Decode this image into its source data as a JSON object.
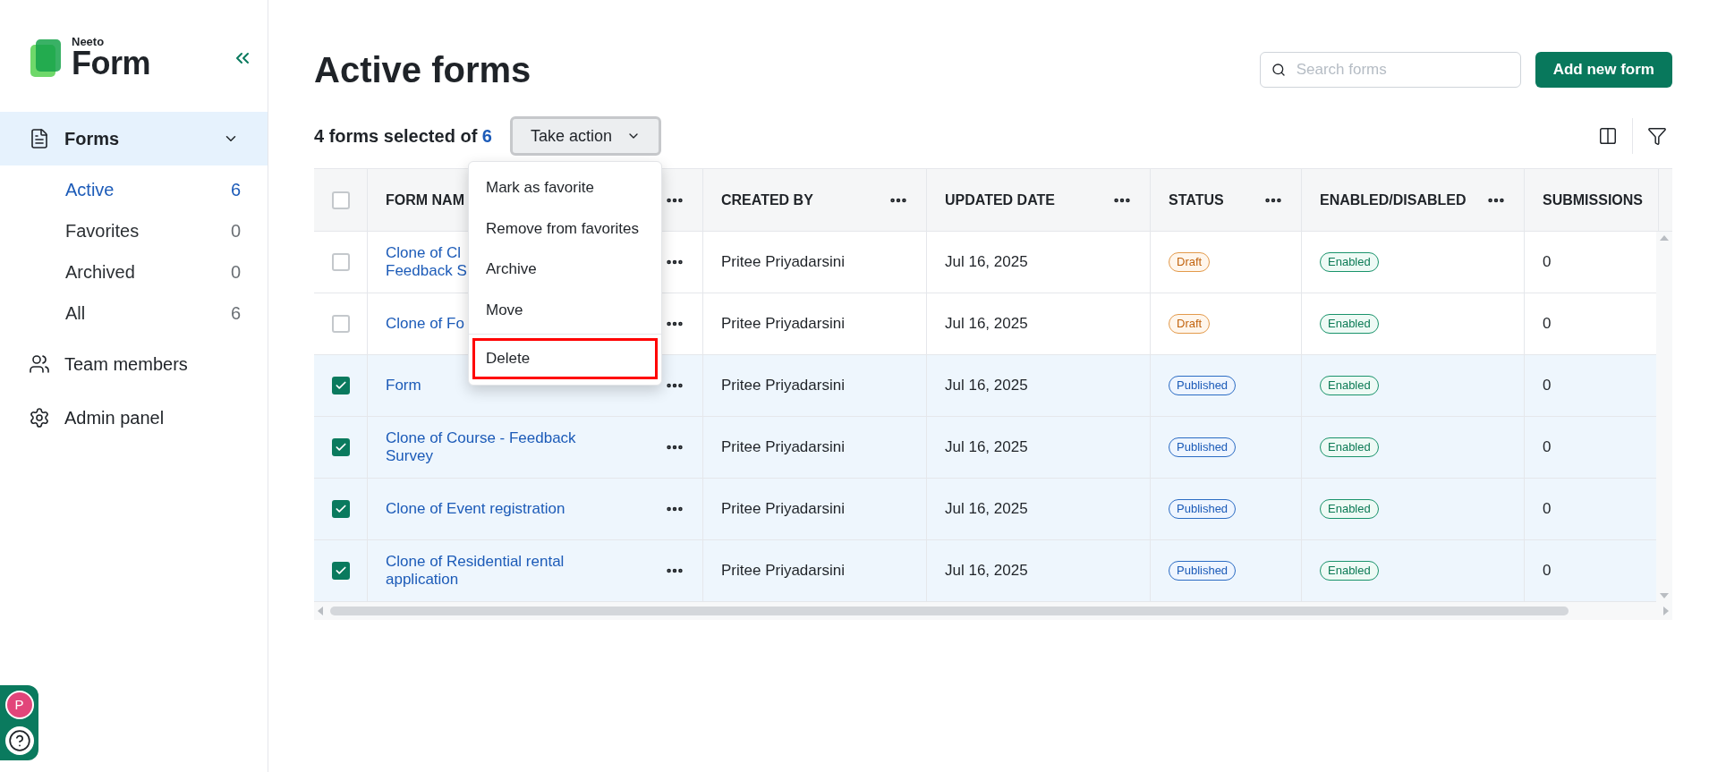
{
  "sidebar": {
    "logo": {
      "small": "Neeto",
      "large": "Form"
    },
    "items": [
      {
        "label": "Forms",
        "selected": true,
        "expanded": true,
        "children": [
          {
            "label": "Active",
            "count": "6",
            "selected": true
          },
          {
            "label": "Favorites",
            "count": "0",
            "selected": false
          },
          {
            "label": "Archived",
            "count": "0",
            "selected": false
          },
          {
            "label": "All",
            "count": "6",
            "selected": false
          }
        ]
      },
      {
        "label": "Team members",
        "selected": false
      },
      {
        "label": "Admin panel",
        "selected": false
      }
    ],
    "user_initial": "P"
  },
  "header": {
    "title": "Active forms",
    "search": {
      "placeholder": "Search forms"
    },
    "add_button": "Add new form"
  },
  "selection": {
    "text": "4 forms selected of",
    "total": "6",
    "action_button": "Take action"
  },
  "action_menu": {
    "items": [
      {
        "label": "Mark as favorite",
        "highlighted": false
      },
      {
        "label": "Remove from favorites",
        "highlighted": false
      },
      {
        "label": "Archive",
        "highlighted": false
      },
      {
        "label": "Move",
        "highlighted": false
      },
      {
        "label": "Delete",
        "highlighted": true
      }
    ]
  },
  "table": {
    "all_selected": false,
    "columns": [
      {
        "label": "FORM NAM",
        "menu": true
      },
      {
        "label": "CREATED BY",
        "menu": true
      },
      {
        "label": "UPDATED DATE",
        "menu": true
      },
      {
        "label": "STATUS",
        "menu": true
      },
      {
        "label": "ENABLED/DISABLED",
        "menu": true
      },
      {
        "label": "SUBMISSIONS"
      }
    ],
    "rows": [
      {
        "selected": false,
        "name_lines": [
          "Clone of Cl",
          "Feedback S"
        ],
        "created_by": "Pritee Priyadarsini",
        "updated": "Jul 16, 2025",
        "status": {
          "label": "Draft",
          "kind": "draft"
        },
        "enabled": "Enabled",
        "submissions": "0"
      },
      {
        "selected": false,
        "name_lines": [
          "Clone of Fo"
        ],
        "created_by": "Pritee Priyadarsini",
        "updated": "Jul 16, 2025",
        "status": {
          "label": "Draft",
          "kind": "draft"
        },
        "enabled": "Enabled",
        "submissions": "0"
      },
      {
        "selected": true,
        "name_lines": [
          "Form"
        ],
        "created_by": "Pritee Priyadarsini",
        "updated": "Jul 16, 2025",
        "status": {
          "label": "Published",
          "kind": "published"
        },
        "enabled": "Enabled",
        "submissions": "0"
      },
      {
        "selected": true,
        "name_lines": [
          "Clone of Course - Feedback",
          "Survey"
        ],
        "created_by": "Pritee Priyadarsini",
        "updated": "Jul 16, 2025",
        "status": {
          "label": "Published",
          "kind": "published"
        },
        "enabled": "Enabled",
        "submissions": "0"
      },
      {
        "selected": true,
        "name_lines": [
          "Clone of Event registration"
        ],
        "created_by": "Pritee Priyadarsini",
        "updated": "Jul 16, 2025",
        "status": {
          "label": "Published",
          "kind": "published"
        },
        "enabled": "Enabled",
        "submissions": "0"
      },
      {
        "selected": true,
        "name_lines": [
          "Clone of Residential rental",
          "application"
        ],
        "created_by": "Pritee Priyadarsini",
        "updated": "Jul 16, 2025",
        "status": {
          "label": "Published",
          "kind": "published"
        },
        "enabled": "Enabled",
        "submissions": "0"
      }
    ]
  }
}
